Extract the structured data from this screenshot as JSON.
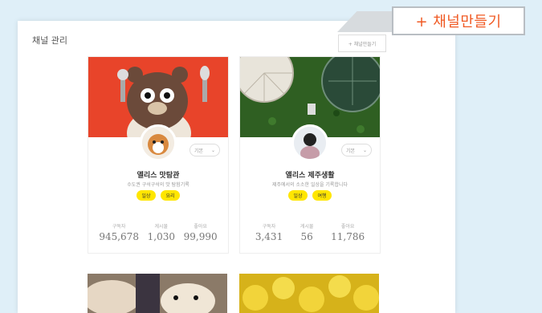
{
  "page": {
    "title": "채널 관리"
  },
  "header": {
    "create_mini_label": "+ 채널만들기",
    "create_callout_label": "+ 채널만들기"
  },
  "colors": {
    "accent": "#f05a24",
    "tag": "#ffe600",
    "background": "#dfeff8"
  },
  "cards": [
    {
      "name": "앨리스 맛탐관",
      "description": "수도권 구석구석의 맛 탐험기록",
      "dropdown": "기본",
      "tags": [
        "일상",
        "요리"
      ],
      "stats": [
        {
          "label": "구독자",
          "value": "945,678"
        },
        {
          "label": "게시물",
          "value": "1,030"
        },
        {
          "label": "좋아요",
          "value": "99,990"
        }
      ]
    },
    {
      "name": "앨리스 제주생활",
      "description": "제주에서의 소소한 일상을 기록합니다",
      "dropdown": "기본",
      "tags": [
        "일상",
        "여행"
      ],
      "stats": [
        {
          "label": "구독자",
          "value": "3,431"
        },
        {
          "label": "게시물",
          "value": "56"
        },
        {
          "label": "좋아요",
          "value": "11,786"
        }
      ]
    }
  ]
}
